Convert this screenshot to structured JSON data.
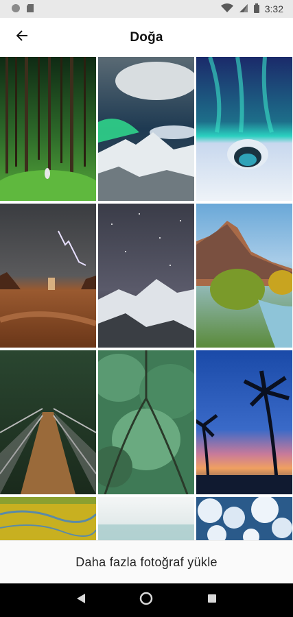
{
  "status_bar": {
    "time": "3:32",
    "icons": [
      "notification-dot-icon",
      "sd-card-icon",
      "wifi-icon",
      "cell-signal-icon",
      "battery-icon"
    ]
  },
  "app_bar": {
    "title": "Doğa",
    "back_icon": "arrow-back-icon"
  },
  "gallery": {
    "photos": [
      {
        "subject": "forest"
      },
      {
        "subject": "aurora-mountains"
      },
      {
        "subject": "aurora-ice-cave"
      },
      {
        "subject": "desert-lightning"
      },
      {
        "subject": "starry-mountain"
      },
      {
        "subject": "canyon-river"
      },
      {
        "subject": "suspension-bridge"
      },
      {
        "subject": "tree-canopy"
      },
      {
        "subject": "palm-sunset"
      },
      {
        "subject": "yellow-meadow"
      },
      {
        "subject": "misty-sea"
      },
      {
        "subject": "snowy-trees"
      }
    ]
  },
  "load_more": {
    "label": "Daha fazla fotoğraf yükle"
  },
  "nav_bar": {
    "icons": [
      "back-triangle-icon",
      "home-circle-icon",
      "recents-square-icon"
    ]
  },
  "colors": {
    "status_bar_bg": "#e9e9e9",
    "nav_bar_bg": "#000000",
    "load_more_bg": "#fafafa"
  }
}
